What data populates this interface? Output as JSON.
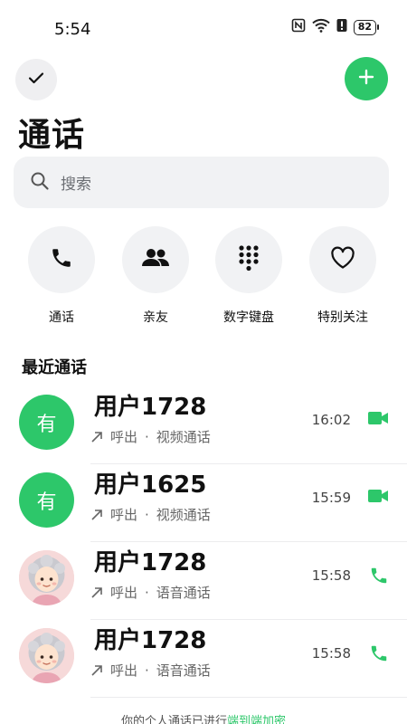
{
  "status": {
    "time": "5:54",
    "battery": "82"
  },
  "header": {
    "title": "通话"
  },
  "search": {
    "placeholder": "搜索"
  },
  "quick_actions": [
    {
      "label": "通话",
      "icon": "phone-icon"
    },
    {
      "label": "亲友",
      "icon": "people-icon"
    },
    {
      "label": "数字键盘",
      "icon": "dialpad-icon"
    },
    {
      "label": "特别关注",
      "icon": "heart-icon"
    }
  ],
  "recent": {
    "title": "最近通话",
    "calls": [
      {
        "name": "用户1728",
        "direction": "呼出",
        "kind": "视频通话",
        "time": "16:02",
        "avatar_text": "有",
        "type_icon": "video-call-icon"
      },
      {
        "name": "用户1625",
        "direction": "呼出",
        "kind": "视频通话",
        "time": "15:59",
        "avatar_text": "有",
        "type_icon": "video-call-icon"
      },
      {
        "name": "用户1728",
        "direction": "呼出",
        "kind": "语音通话",
        "time": "15:58",
        "avatar_text": "",
        "type_icon": "phone-icon"
      },
      {
        "name": "用户1728",
        "direction": "呼出",
        "kind": "语音通话",
        "time": "15:58",
        "avatar_text": "",
        "type_icon": "phone-icon"
      }
    ]
  },
  "footer": {
    "text": "你的个人通话已进行",
    "highlight": "端到端加密"
  },
  "colors": {
    "accent": "#2dc76a",
    "surface": "#f1f2f4",
    "text": "#111111"
  }
}
